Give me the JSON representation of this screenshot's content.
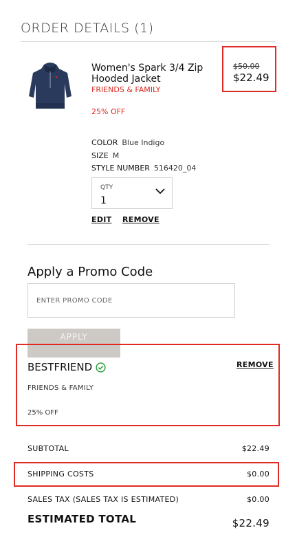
{
  "header": {
    "title": "ORDER DETAILS (1)"
  },
  "item": {
    "name": "Women's Spark 3/4 Zip Hooded Jacket",
    "promo_tag": "FRIENDS & FAMILY",
    "discount": "25% OFF",
    "original_price": "$50.00",
    "sale_price": "$22.49",
    "attributes": [
      {
        "key": "COLOR",
        "value": "Blue Indigo"
      },
      {
        "key": "SIZE",
        "value": "M"
      },
      {
        "key": "STYLE NUMBER",
        "value": "516420_04"
      }
    ],
    "qty_label": "QTY",
    "qty_value": "1",
    "edit_label": "EDIT",
    "remove_label": "REMOVE"
  },
  "promo": {
    "title": "Apply a Promo Code",
    "placeholder": "ENTER PROMO CODE",
    "apply_label": "APPLY",
    "applied_code": "BESTFRIEND",
    "remove_label": "REMOVE",
    "code_group": "FRIENDS & FAMILY",
    "code_discount": "25% OFF"
  },
  "summary": {
    "subtotal_label": "SUBTOTAL",
    "subtotal_value": "$22.49",
    "shipping_label": "SHIPPING COSTS",
    "shipping_value": "$0.00",
    "tax_label": "SALES TAX (SALES TAX IS ESTIMATED)",
    "tax_value": "$0.00",
    "total_label": "ESTIMATED TOTAL",
    "total_value": "$22.49"
  },
  "colors": {
    "accent_red": "#d9281e",
    "highlight_border": "#e02b24",
    "check_green": "#2e9b3e",
    "jacket_navy": "#2a3a5c"
  },
  "icons": {
    "qty_dropdown": "chevron-down-icon",
    "code_valid": "check-circle-icon",
    "product_image": "jacket-image"
  }
}
